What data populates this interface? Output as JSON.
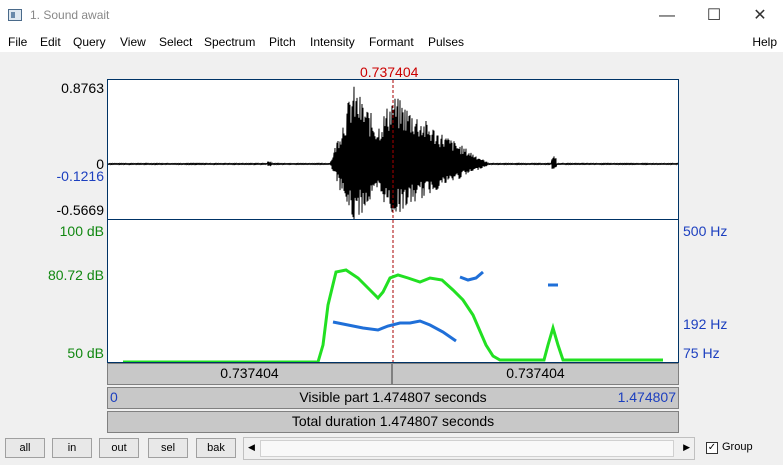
{
  "window": {
    "title": "1. Sound await",
    "minimize": "—",
    "maximize": "☐",
    "close": "✕"
  },
  "menu": {
    "items": [
      "File",
      "Edit",
      "Query",
      "View",
      "Select",
      "Spectrum",
      "Pitch",
      "Intensity",
      "Formant",
      "Pulses"
    ],
    "help": "Help"
  },
  "cursor_time": "0.737404",
  "waveform": {
    "max_label": "0.8763",
    "zero_label": "0",
    "cursor_value": "-0.1216",
    "min_label": "-0.5669"
  },
  "intensity": {
    "top_label": "100 dB",
    "mid_label": "80.72 dB",
    "bottom_label": "50 dB",
    "color": "#22e022"
  },
  "pitch": {
    "top_label": "500 Hz",
    "mid_label": "192 Hz",
    "bottom_label": "75 Hz",
    "color": "#1f6fd8"
  },
  "time_bar": {
    "left": "0.737404",
    "right": "0.737404"
  },
  "visible_bar": {
    "start": "0",
    "label": "Visible part 1.474807 seconds",
    "end": "1.474807"
  },
  "total_bar": {
    "label": "Total duration 1.474807 seconds"
  },
  "buttons": {
    "all": "all",
    "in": "in",
    "out": "out",
    "sel": "sel",
    "bak": "bak"
  },
  "group": {
    "label": "Group",
    "checked": "✓"
  }
}
